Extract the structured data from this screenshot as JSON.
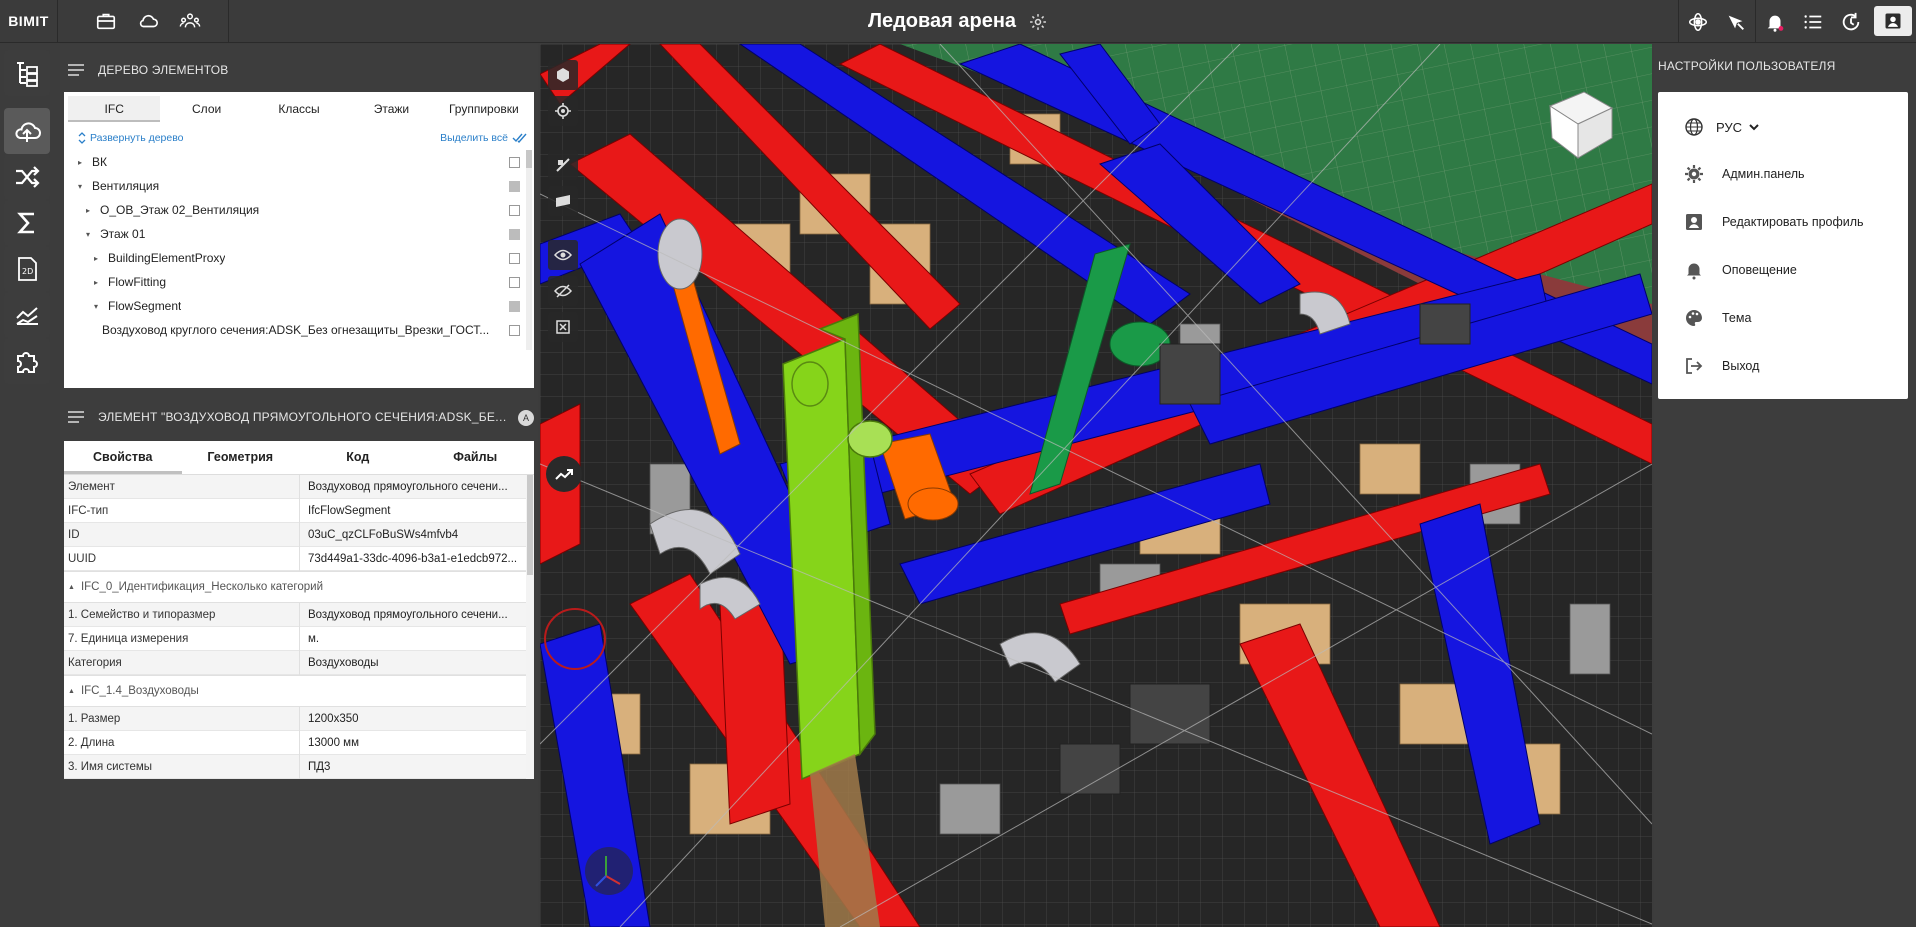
{
  "app": {
    "logo": "BIMIT",
    "project_title": "Ледовая арена"
  },
  "topbar": {
    "left_icons": [
      "briefcase-icon",
      "cloud-icon",
      "team-icon"
    ],
    "right_icons": [
      "orbit-icon",
      "pan-icon",
      "bell-icon",
      "list-icon",
      "history-icon",
      "account-icon"
    ]
  },
  "rail": [
    "tree-icon",
    "cloud-model-icon",
    "shuffle-icon",
    "sum-icon",
    "2d-icon",
    "chart-icon",
    "plugin-icon"
  ],
  "tree_panel": {
    "title": "ДЕРЕВО ЭЛЕМЕНТОВ",
    "tabs": [
      "IFC",
      "Слои",
      "Классы",
      "Этажи",
      "Группировки"
    ],
    "expand_label": "Развернуть дерево",
    "select_all_label": "Выделить всё",
    "items": [
      {
        "label": "ВК",
        "level": 0,
        "caret": "▸",
        "check": "empty"
      },
      {
        "label": "Вентиляция",
        "level": 0,
        "caret": "▾",
        "check": "partial"
      },
      {
        "label": "О_ОВ_Этаж 02_Вентиляция",
        "level": 1,
        "caret": "▸",
        "check": "empty"
      },
      {
        "label": "Этаж 01",
        "level": 1,
        "caret": "▾",
        "check": "partial"
      },
      {
        "label": "BuildingElementProxy",
        "level": 2,
        "caret": "▸",
        "check": "empty"
      },
      {
        "label": "FlowFitting",
        "level": 2,
        "caret": "▸",
        "check": "empty"
      },
      {
        "label": "FlowSegment",
        "level": 2,
        "caret": "▾",
        "check": "partial"
      },
      {
        "label": "Воздуховод круглого сечения:ADSK_Без огнезащиты_Врезки_ГОСТ...",
        "level": 3,
        "caret": "",
        "check": "empty"
      }
    ]
  },
  "element_panel": {
    "title": "ЭЛЕМЕНТ \"ВОЗДУХОВОД ПРЯМОУГОЛЬНОГО СЕЧЕНИЯ:ADSK_БЕЗ ОГН...",
    "badge": "A",
    "tabs": [
      "Свойства",
      "Геометрия",
      "Код",
      "Файлы"
    ],
    "base_rows": [
      {
        "k": "Элемент",
        "v": "Воздуховод прямоугольного сечени..."
      },
      {
        "k": "IFC-тип",
        "v": "IfcFlowSegment"
      },
      {
        "k": "ID",
        "v": "03uC_qzCLFoBuSWs4mfvb4"
      },
      {
        "k": "UUID",
        "v": "73d449a1-33dc-4096-b3a1-e1edcb972..."
      }
    ],
    "group1": "IFC_0_Идентификация_Несколько категорий",
    "group1_rows": [
      {
        "k": "1. Семейство и типоразмер",
        "v": "Воздуховод прямоугольного сечени..."
      },
      {
        "k": "7. Единица измерения",
        "v": "м."
      },
      {
        "k": "Категория",
        "v": "Воздуховоды"
      }
    ],
    "group2": "IFC_1.4_Воздуховоды",
    "group2_rows": [
      {
        "k": "1. Размер",
        "v": "1200x350"
      },
      {
        "k": "2. Длина",
        "v": "13000 мм"
      },
      {
        "k": "3. Имя системы",
        "v": "ПД3"
      }
    ]
  },
  "user_settings": {
    "title": "НАСТРОЙКИ ПОЛЬЗОВАТЕЛЯ",
    "language": "РУС",
    "items": [
      {
        "label": "Админ.панель",
        "icon": "gear-icon"
      },
      {
        "label": "Редактировать профиль",
        "icon": "profile-icon"
      },
      {
        "label": "Оповещение",
        "icon": "bell-icon"
      },
      {
        "label": "Тема",
        "icon": "palette-icon"
      },
      {
        "label": "Выход",
        "icon": "logout-icon"
      }
    ]
  },
  "viewport": {
    "tools": [
      "cube-icon",
      "target-icon",
      "section-icon",
      "plane-icon",
      "eye-icon",
      "hide-icon",
      "clear-section-icon"
    ],
    "trend": "trend-icon"
  },
  "colors": {
    "dark_bg": "#3c3c3c",
    "duct_red": "#e81818",
    "duct_blue": "#1313e0",
    "duct_green_sel": "#86d41a",
    "link_blue": "#2a7fc9"
  }
}
